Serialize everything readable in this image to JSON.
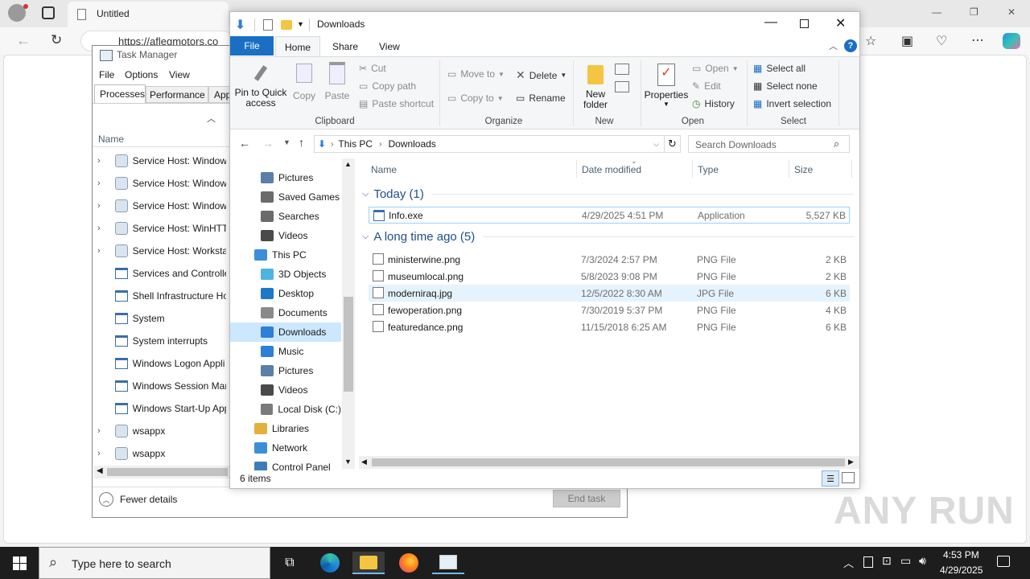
{
  "edge": {
    "tab_title": "Untitled",
    "address": "https://aflegmotors.co",
    "min": "—",
    "max": "❐",
    "close": "✕"
  },
  "task_manager": {
    "title": "Task Manager",
    "menu": [
      "File",
      "Options",
      "View"
    ],
    "tabs": [
      "Processes",
      "Performance",
      "App"
    ],
    "column_name": "Name",
    "rows": [
      {
        "label": "Service Host: Windows",
        "icon": "gear",
        "expand": true
      },
      {
        "label": "Service Host: Windows",
        "icon": "gear",
        "expand": true
      },
      {
        "label": "Service Host: Windows",
        "icon": "gear",
        "expand": true
      },
      {
        "label": "Service Host: WinHTTP",
        "icon": "gear",
        "expand": true
      },
      {
        "label": "Service Host: Workstat",
        "icon": "gear",
        "expand": true
      },
      {
        "label": "Services and Controlle",
        "icon": "window",
        "expand": false
      },
      {
        "label": "Shell Infrastructure Ho",
        "icon": "window",
        "expand": false
      },
      {
        "label": "System",
        "icon": "window",
        "expand": false
      },
      {
        "label": "System interrupts",
        "icon": "window",
        "expand": false
      },
      {
        "label": "Windows Logon Appli",
        "icon": "window",
        "expand": false
      },
      {
        "label": "Windows Session Man",
        "icon": "window",
        "expand": false
      },
      {
        "label": "Windows Start-Up App",
        "icon": "window",
        "expand": false
      },
      {
        "label": "wsappx",
        "icon": "gear",
        "expand": true
      },
      {
        "label": "wsappx",
        "icon": "gear",
        "expand": true
      }
    ],
    "fewer_details": "Fewer details",
    "end_task": "End task"
  },
  "explorer": {
    "title": "Downloads",
    "ribbon_tabs": [
      "File",
      "Home",
      "Share",
      "View"
    ],
    "clipboard": {
      "pin": "Pin to Quick access",
      "copy": "Copy",
      "paste": "Paste",
      "cut": "Cut",
      "copy_path": "Copy path",
      "paste_shortcut": "Paste shortcut",
      "label": "Clipboard"
    },
    "organize": {
      "move_to": "Move to",
      "copy_to": "Copy to",
      "delete": "Delete",
      "rename": "Rename",
      "label": "Organize"
    },
    "new": {
      "new_folder": "New folder",
      "label": "New"
    },
    "open": {
      "properties": "Properties",
      "open": "Open",
      "edit": "Edit",
      "history": "History",
      "label": "Open"
    },
    "select": {
      "select_all": "Select all",
      "select_none": "Select none",
      "invert": "Invert selection",
      "label": "Select"
    },
    "breadcrumb": [
      "This PC",
      "Downloads"
    ],
    "search_placeholder": "Search Downloads",
    "nav_items": [
      {
        "label": "Pictures",
        "indent": 1,
        "color": "#5b7fa6"
      },
      {
        "label": "Saved Games",
        "indent": 1,
        "color": "#6b6b6b"
      },
      {
        "label": "Searches",
        "indent": 1,
        "color": "#6b6b6b"
      },
      {
        "label": "Videos",
        "indent": 1,
        "color": "#4a4a4a"
      },
      {
        "label": "This PC",
        "indent": 0,
        "color": "#3c8fd6"
      },
      {
        "label": "3D Objects",
        "indent": 1,
        "color": "#4fb3e0"
      },
      {
        "label": "Desktop",
        "indent": 1,
        "color": "#1e78c8"
      },
      {
        "label": "Documents",
        "indent": 1,
        "color": "#8a8a8a"
      },
      {
        "label": "Downloads",
        "indent": 1,
        "color": "#2f7fd6"
      },
      {
        "label": "Music",
        "indent": 1,
        "color": "#2f7fd6"
      },
      {
        "label": "Pictures",
        "indent": 1,
        "color": "#5b7fa6"
      },
      {
        "label": "Videos",
        "indent": 1,
        "color": "#4a4a4a"
      },
      {
        "label": "Local Disk (C:)",
        "indent": 1,
        "color": "#7a7a7a"
      },
      {
        "label": "Libraries",
        "indent": 0,
        "color": "#e2b13c"
      },
      {
        "label": "Network",
        "indent": 0,
        "color": "#3c8fd6"
      },
      {
        "label": "Control Panel",
        "indent": 0,
        "color": "#3c7fb6"
      }
    ],
    "columns": [
      "Name",
      "Date modified",
      "Type",
      "Size"
    ],
    "groups": [
      {
        "label": "Today (1)",
        "files": [
          {
            "name": "Info.exe",
            "date": "4/29/2025 4:51 PM",
            "type": "Application",
            "size": "5,527 KB",
            "selected": true
          }
        ]
      },
      {
        "label": "A long time ago (5)",
        "files": [
          {
            "name": "ministerwine.png",
            "date": "7/3/2024 2:57 PM",
            "type": "PNG File",
            "size": "2 KB"
          },
          {
            "name": "museumlocal.png",
            "date": "5/8/2023 9:08 PM",
            "type": "PNG File",
            "size": "2 KB"
          },
          {
            "name": "moderniraq.jpg",
            "date": "12/5/2022 8:30 AM",
            "type": "JPG File",
            "size": "6 KB",
            "hover": true
          },
          {
            "name": "fewoperation.png",
            "date": "7/30/2019 5:37 PM",
            "type": "PNG File",
            "size": "4 KB"
          },
          {
            "name": "featuredance.png",
            "date": "11/15/2018 6:25 AM",
            "type": "PNG File",
            "size": "6 KB"
          }
        ]
      }
    ],
    "status": "6 items"
  },
  "taskbar": {
    "search_placeholder": "Type here to search",
    "time": "4:53 PM",
    "date": "4/29/2025"
  },
  "watermark": "ANY RUN"
}
